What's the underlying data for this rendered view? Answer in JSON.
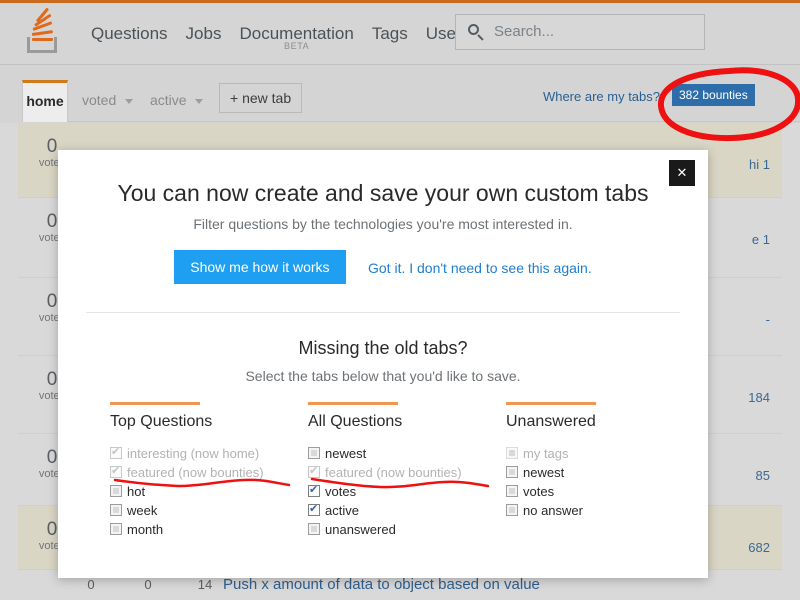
{
  "header": {
    "logo_name": "stack-overflow-logo",
    "nav": [
      {
        "label": "Questions",
        "sub": ""
      },
      {
        "label": "Jobs",
        "sub": ""
      },
      {
        "label": "Documentation",
        "sub": "BETA"
      },
      {
        "label": "Tags",
        "sub": ""
      },
      {
        "label": "Users",
        "sub": ""
      }
    ],
    "search": {
      "placeholder": "Search...",
      "value": "",
      "icon": "search-icon"
    }
  },
  "tabbar": {
    "home": "home",
    "voted": "voted",
    "active": "active",
    "new_tab": "+ new tab",
    "where_are_my_tabs": "Where are my tabs?",
    "bounties_badge": "382 bounties"
  },
  "background": {
    "rows": [
      {
        "votes": "0",
        "votes_label": "votes",
        "meta": "hi 1",
        "alt": true
      },
      {
        "votes": "0",
        "votes_label": "votes",
        "meta": "e 1",
        "alt": false
      },
      {
        "votes": "0",
        "votes_label": "votes",
        "meta": "-",
        "alt": false
      },
      {
        "votes": "0",
        "votes_label": "votes",
        "meta": "184",
        "alt": false
      },
      {
        "votes": "0",
        "votes_label": "votes",
        "meta": "85",
        "alt": false
      },
      {
        "votes": "0",
        "votes_label": "votes",
        "meta": "682",
        "alt": true
      }
    ],
    "bottom_row": {
      "c1": "0",
      "c2": "0",
      "c3": "14",
      "title": "Push x amount of data to object based on value"
    }
  },
  "modal": {
    "close_label": "✕",
    "title": "You can now create and save your own custom tabs",
    "subtitle": "Filter questions by the technologies you're most interested in.",
    "primary_button": "Show me how it works",
    "dismiss_link": "Got it. I don't need to see this again.",
    "section_title": "Missing the old tabs?",
    "section_subtitle": "Select the tabs below that you'd like to save.",
    "columns": [
      {
        "heading": "Top Questions",
        "options": [
          {
            "label": "interesting (now home)",
            "state": "checked-disabled"
          },
          {
            "label": "featured (now bounties)",
            "state": "checked-disabled"
          },
          {
            "label": "hot",
            "state": "unchecked"
          },
          {
            "label": "week",
            "state": "unchecked"
          },
          {
            "label": "month",
            "state": "unchecked"
          }
        ]
      },
      {
        "heading": "All Questions",
        "options": [
          {
            "label": "newest",
            "state": "unchecked"
          },
          {
            "label": "featured (now bounties)",
            "state": "checked-disabled"
          },
          {
            "label": "votes",
            "state": "checked"
          },
          {
            "label": "active",
            "state": "checked"
          },
          {
            "label": "unanswered",
            "state": "unchecked"
          }
        ]
      },
      {
        "heading": "Unanswered",
        "options": [
          {
            "label": "my tags",
            "state": "unchecked-disabled"
          },
          {
            "label": "newest",
            "state": "unchecked"
          },
          {
            "label": "votes",
            "state": "unchecked"
          },
          {
            "label": "no answer",
            "state": "unchecked"
          }
        ]
      }
    ]
  },
  "annotations": {
    "color": "#ee1111",
    "circle_target": "382 bounties",
    "underline_targets": [
      "featured (now bounties)",
      "featured (now bounties)"
    ]
  },
  "colors": {
    "accent_orange": "#e0691a",
    "primary_blue": "#1e9ff2",
    "badge_blue": "#2d6daa",
    "annotation_red": "#ee1111",
    "column_rule": "#ef9750"
  }
}
